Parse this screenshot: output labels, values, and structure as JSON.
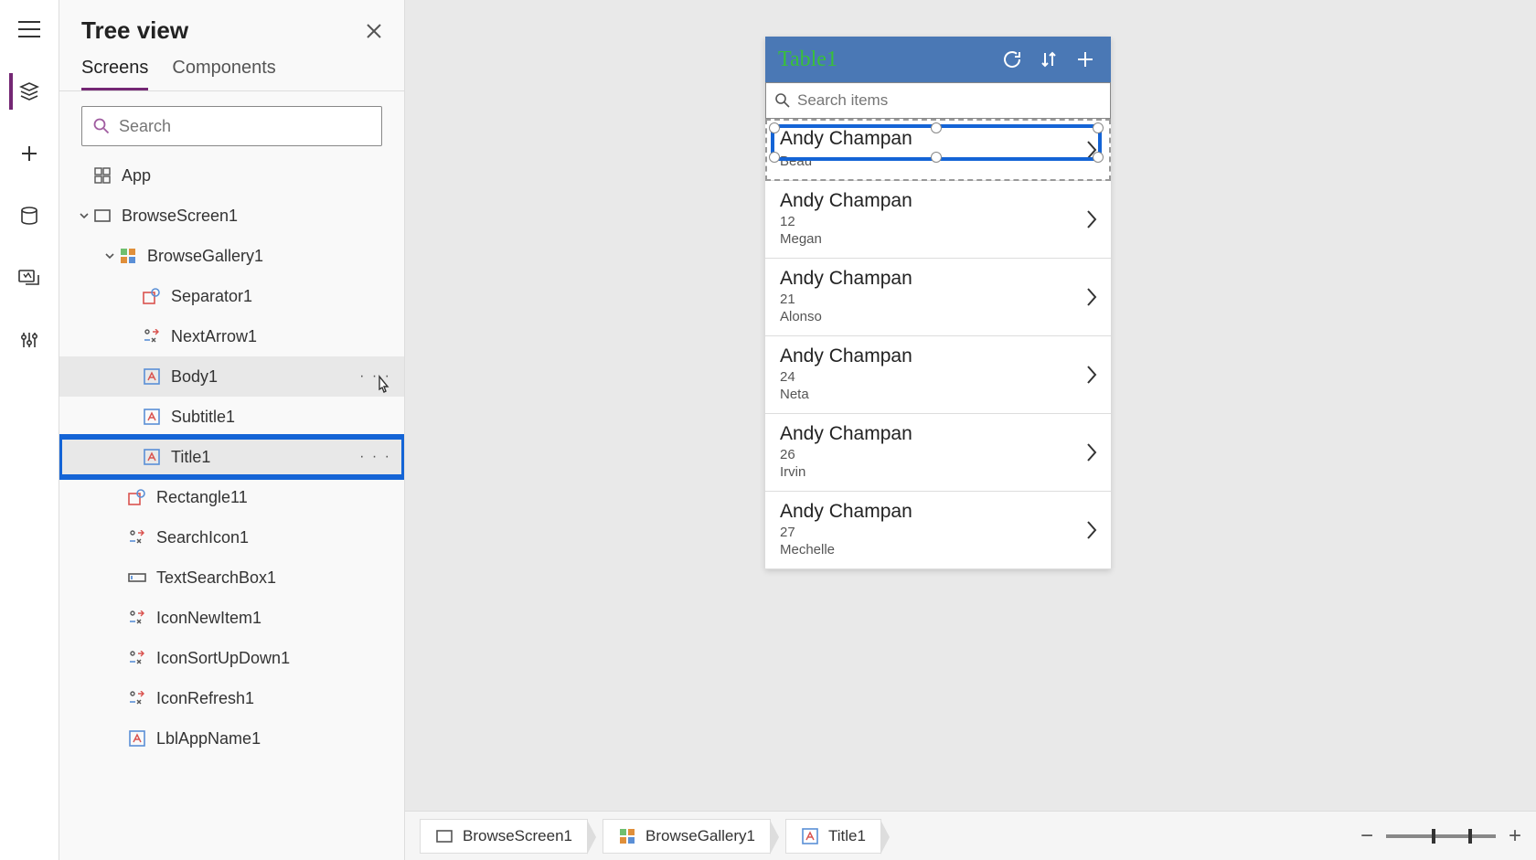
{
  "panel": {
    "title": "Tree view",
    "tabs": {
      "screens": "Screens",
      "components": "Components"
    },
    "search_placeholder": "Search"
  },
  "tree": {
    "app": "App",
    "browse_screen": "BrowseScreen1",
    "browse_gallery": "BrowseGallery1",
    "separator": "Separator1",
    "next_arrow": "NextArrow1",
    "body": "Body1",
    "subtitle": "Subtitle1",
    "title": "Title1",
    "rectangle": "Rectangle11",
    "search_icon": "SearchIcon1",
    "text_search_box": "TextSearchBox1",
    "icon_new_item": "IconNewItem1",
    "icon_sort": "IconSortUpDown1",
    "icon_refresh": "IconRefresh1",
    "lbl_app_name": "LblAppName1"
  },
  "more_glyph": "· · ·",
  "preview": {
    "app_title": "Table1",
    "search_placeholder": "Search items",
    "items": [
      {
        "title": "Andy Champan",
        "sub": "",
        "body": "Beau"
      },
      {
        "title": "Andy Champan",
        "sub": "12",
        "body": "Megan"
      },
      {
        "title": "Andy Champan",
        "sub": "21",
        "body": "Alonso"
      },
      {
        "title": "Andy Champan",
        "sub": "24",
        "body": "Neta"
      },
      {
        "title": "Andy Champan",
        "sub": "26",
        "body": "Irvin"
      },
      {
        "title": "Andy Champan",
        "sub": "27",
        "body": "Mechelle"
      }
    ]
  },
  "breadcrumbs": {
    "screen": "BrowseScreen1",
    "gallery": "BrowseGallery1",
    "control": "Title1"
  },
  "zoom": {
    "minus": "−",
    "plus": "+"
  }
}
